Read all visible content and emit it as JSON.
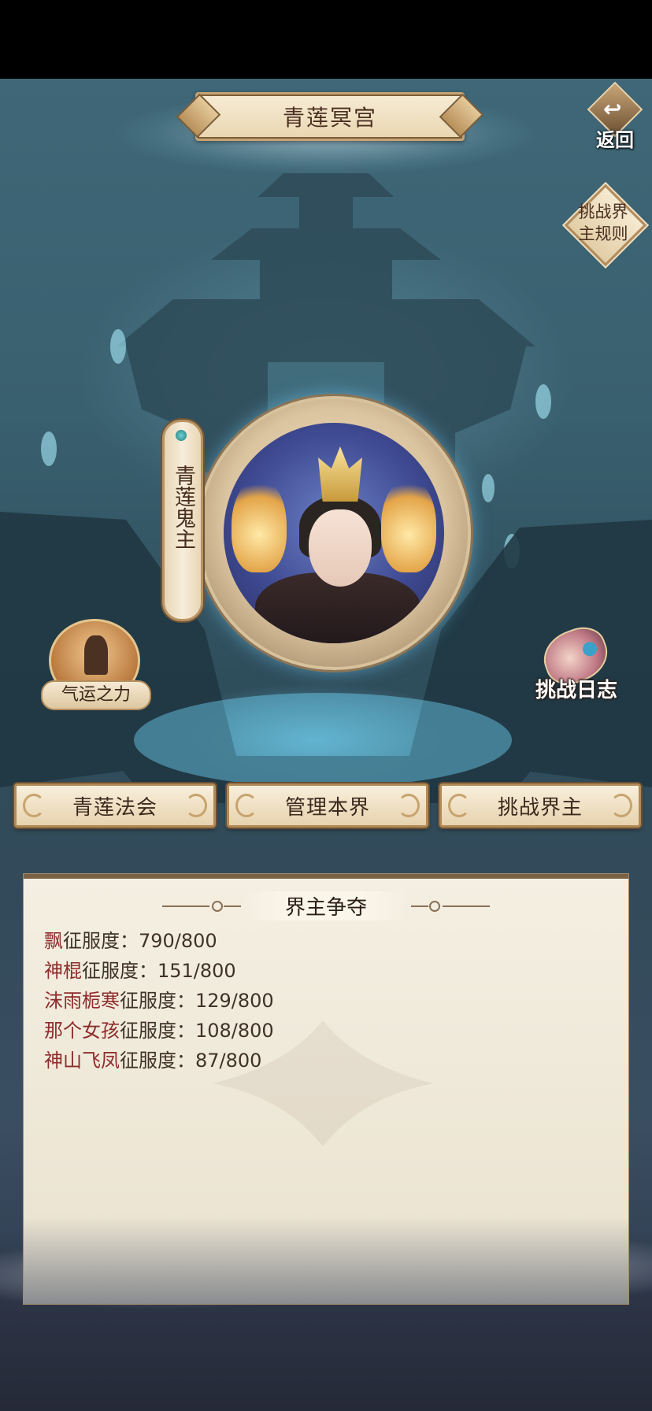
{
  "header": {
    "title": "青莲冥宫",
    "back_label": "返回",
    "rules_label": "挑战界主规则"
  },
  "boss": {
    "name": "青莲鬼主"
  },
  "side_buttons": {
    "fortune_label": "气运之力",
    "log_label": "挑战日志"
  },
  "actions": [
    {
      "label": "青莲法会"
    },
    {
      "label": "管理本界"
    },
    {
      "label": "挑战界主"
    }
  ],
  "panel": {
    "title": "界主争夺",
    "metric_label": "征服度：",
    "rows": [
      {
        "player": "飘",
        "progress": "790/800"
      },
      {
        "player": "神棍",
        "progress": "151/800"
      },
      {
        "player": "沫雨栀寒",
        "progress": "129/800"
      },
      {
        "player": "那个女孩",
        "progress": "108/800"
      },
      {
        "player": "神山飞凤",
        "progress": "87/800"
      }
    ]
  },
  "colors": {
    "accent_gold": "#c6a371",
    "player_name": "#8d2c2c",
    "panel_bg": "#f4efe2"
  },
  "icons": {
    "back": "back-arrow-icon",
    "fortune": "fortune-meditation-icon",
    "log": "challenge-scroll-icon"
  }
}
